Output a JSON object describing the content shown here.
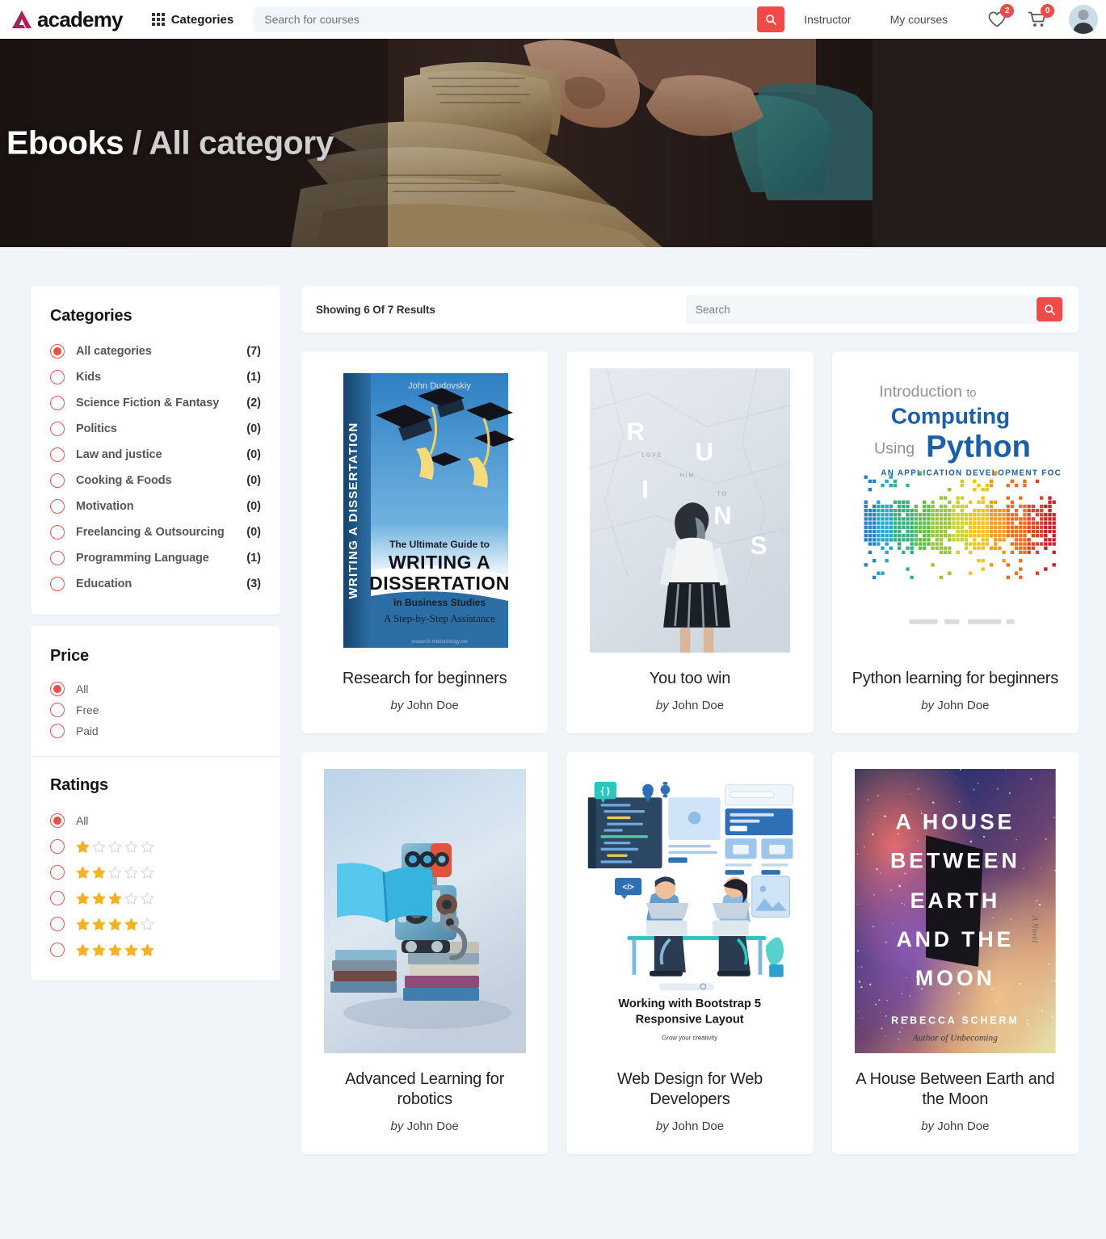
{
  "header": {
    "brand": "academy",
    "brand_color": "#c2185b",
    "categories_label": "Categories",
    "search_placeholder": "Search for courses",
    "nav": [
      {
        "label": "Instructor"
      },
      {
        "label": "My courses"
      }
    ],
    "wishlist_count": "2",
    "cart_count": "0",
    "accent_color": "#f04b48"
  },
  "hero": {
    "title_main": "Ebooks",
    "title_rest": " / All category"
  },
  "sidebar": {
    "categories_title": "Categories",
    "categories": [
      {
        "label": "All categories",
        "count": "(7)",
        "selected": true
      },
      {
        "label": "Kids",
        "count": "(1)",
        "selected": false
      },
      {
        "label": "Science Fiction & Fantasy",
        "count": "(2)",
        "selected": false
      },
      {
        "label": "Politics",
        "count": "(0)",
        "selected": false
      },
      {
        "label": "Law and justice",
        "count": "(0)",
        "selected": false
      },
      {
        "label": "Cooking & Foods",
        "count": "(0)",
        "selected": false
      },
      {
        "label": "Motivation",
        "count": "(0)",
        "selected": false
      },
      {
        "label": "Freelancing & Outsourcing",
        "count": "(0)",
        "selected": false
      },
      {
        "label": "Programming Language",
        "count": "(1)",
        "selected": false
      },
      {
        "label": "Education",
        "count": "(3)",
        "selected": false
      }
    ],
    "price_title": "Price",
    "price_options": [
      {
        "label": "All",
        "selected": true
      },
      {
        "label": "Free",
        "selected": false
      },
      {
        "label": "Paid",
        "selected": false
      }
    ],
    "ratings_title": "Ratings",
    "ratings_all_label": "All",
    "ratings_options": [
      {
        "stars": 1,
        "selected": false
      },
      {
        "stars": 2,
        "selected": false
      },
      {
        "stars": 3,
        "selected": false
      },
      {
        "stars": 4,
        "selected": false
      },
      {
        "stars": 5,
        "selected": false
      }
    ],
    "star_filled_color": "#f5b324",
    "star_empty_color": "#d6d9dd"
  },
  "results": {
    "showing_text": "Showing 6 Of 7 Results",
    "search_placeholder": "Search",
    "books": [
      {
        "title": "Research for beginners",
        "by_prefix": "by",
        "author": "John Doe",
        "cover": "writing-a-dissertation",
        "cover_texts": {
          "spine": "WRITING A DISSERTATION",
          "author": "John Dudovskiy",
          "line1": "The Ultimate Guide to",
          "line2": "WRITING A",
          "line3": "DISSERTATION",
          "line4": "in Business Studies",
          "line5": "A Step-by-Step Assistance",
          "footer": "research-methodology.net"
        }
      },
      {
        "title": "You too win",
        "by_prefix": "by",
        "author": "John Doe",
        "cover": "ruins",
        "cover_texts": {
          "big": "RUINS",
          "small1": "LOVE",
          "small2": "HIM",
          "small3": "TO"
        }
      },
      {
        "title": "Python learning for beginners",
        "by_prefix": "by",
        "author": "John Doe",
        "cover": "intro-computing-python",
        "cover_texts": {
          "line1a": "Introduction",
          "line1b": "to",
          "line2": "Computing",
          "line3a": "Using",
          "line3b": "Python",
          "line4": "AN APPLICATION DEVELOPMENT FOCUS"
        }
      },
      {
        "title": "Advanced Learning for robotics",
        "by_prefix": "by",
        "author": "John Doe",
        "cover": "reading-robot",
        "cover_texts": {}
      },
      {
        "title": "Web Design for Web Developers",
        "by_prefix": "by",
        "author": "John Doe",
        "cover": "bootstrap-5",
        "cover_texts": {
          "line1": "Working with Bootstrap 5",
          "line2": "Responsive Layout",
          "tagline": "Grow your creativity",
          "badge1": "{ }",
          "badge2": "</>"
        }
      },
      {
        "title": "A House Between Earth and the Moon",
        "by_prefix": "by",
        "author": "John Doe",
        "cover": "house-between-earth-moon",
        "cover_texts": {
          "l1": "A HOUSE",
          "l2": "BETWEEN",
          "l3": "EARTH",
          "l4": "AND THE",
          "l5": "MOON",
          "author": "REBECCA SCHERM",
          "sub": "Author of Unbecoming",
          "novel": "A Novel"
        }
      }
    ]
  }
}
